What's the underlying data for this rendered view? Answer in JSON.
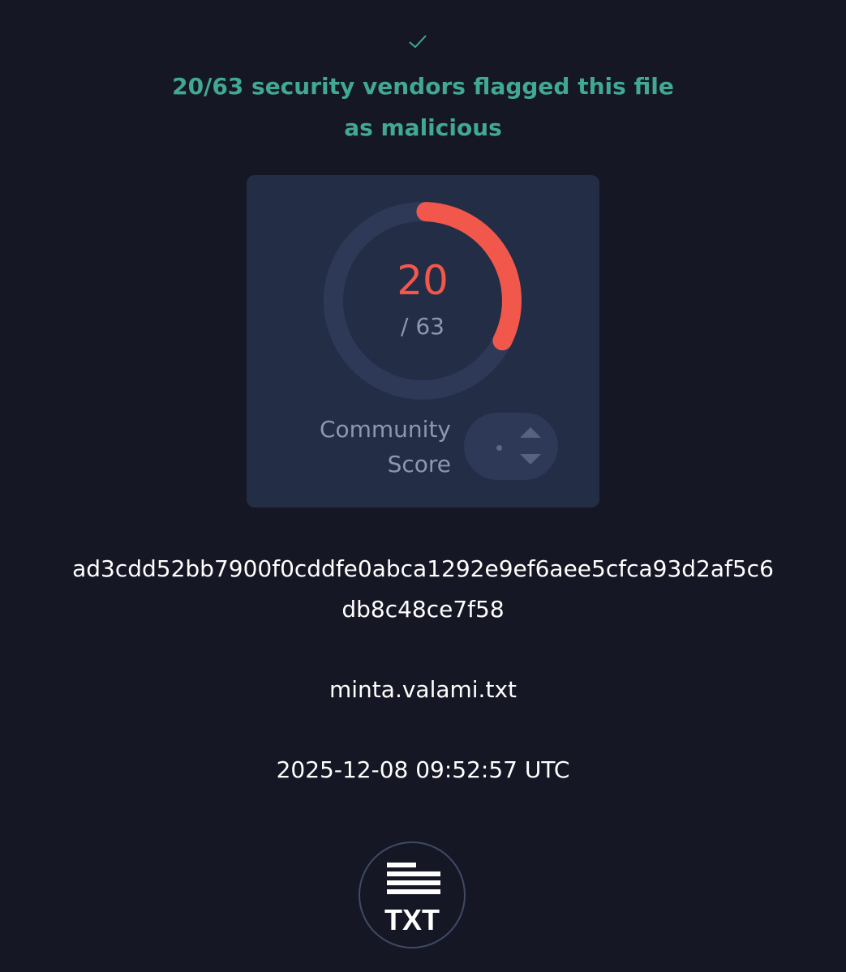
{
  "status": {
    "icon": "check-icon",
    "headline_line1": "20/63 security vendors flagged this file",
    "headline_line2": "as malicious",
    "accent_color": "#41a895"
  },
  "detection": {
    "score": "20",
    "total": "/ 63",
    "flagged": 20,
    "total_vendors": 63,
    "gauge_color": "#f1584b",
    "track_color": "#2d3957"
  },
  "community": {
    "label_line1": "Community",
    "label_line2": "Score",
    "value": "•",
    "upvote_icon": "triangle-up-icon",
    "downvote_icon": "triangle-down-icon"
  },
  "file": {
    "hash_line1": "ad3cdd52bb7900f0cddfe0abca1292e9ef6aee5cfca93d2af5c6",
    "hash_line2": "db8c48ce7f58",
    "name": "minta.valami.txt",
    "date": "2025-12-08 09:52:57 UTC",
    "type_label": "TXT",
    "type_icon": "txt-file-icon"
  }
}
